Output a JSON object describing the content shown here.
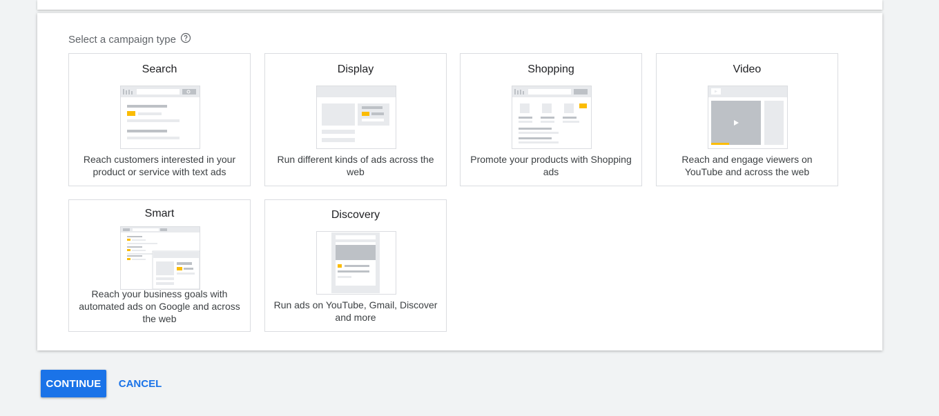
{
  "section": {
    "label": "Select a campaign type",
    "help_icon": "help-circle-icon"
  },
  "campaign_types": [
    {
      "title": "Search",
      "description": "Reach customers interested in your product or service with text ads"
    },
    {
      "title": "Display",
      "description": "Run different kinds of ads across the web"
    },
    {
      "title": "Shopping",
      "description": "Promote your products with Shopping ads"
    },
    {
      "title": "Video",
      "description": "Reach and engage viewers on YouTube and across the web"
    },
    {
      "title": "Smart",
      "description": "Reach your business goals with automated ads on Google and across the web"
    },
    {
      "title": "Discovery",
      "description": "Run ads on YouTube, Gmail, Discover and more"
    }
  ],
  "actions": {
    "continue_label": "CONTINUE",
    "cancel_label": "CANCEL"
  },
  "colors": {
    "accent": "#1a73e8",
    "ad_highlight": "#fbbc04",
    "border": "#dadce0",
    "page_bg": "#f1f3f4"
  }
}
